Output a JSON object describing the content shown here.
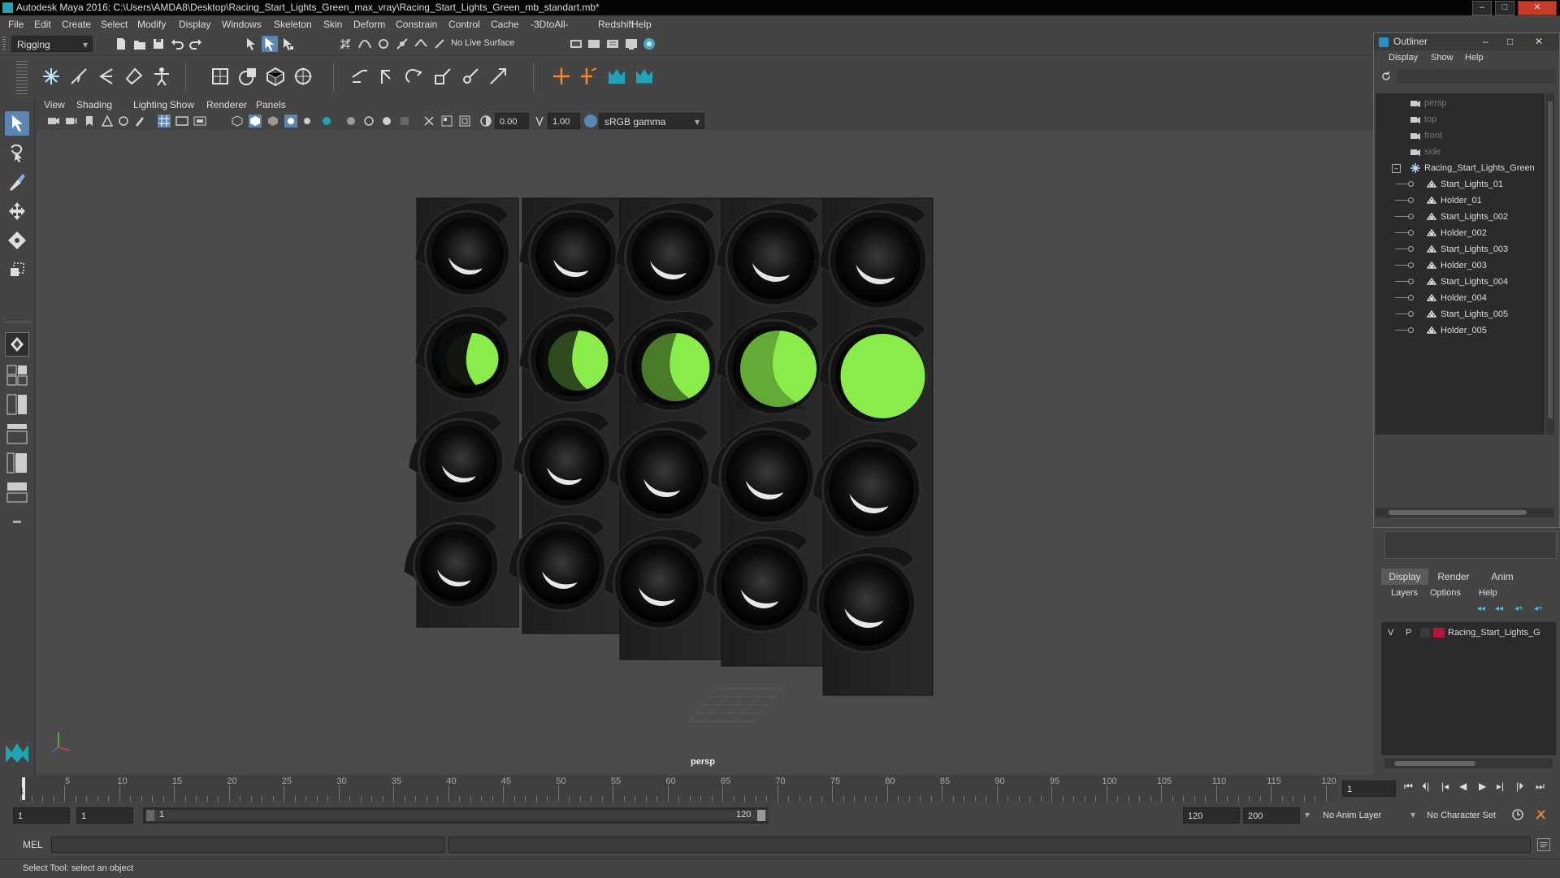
{
  "window": {
    "title": "Autodesk Maya 2016: C:\\Users\\AMDA8\\Desktop\\Racing_Start_Lights_Green_max_vray\\Racing_Start_Lights_Green_mb_standart.mb*",
    "minimize": "–",
    "maximize": "□",
    "close": "✕"
  },
  "menubar": [
    "File",
    "Edit",
    "Create",
    "Select",
    "Modify",
    "Display",
    "Windows",
    "Skeleton",
    "Skin",
    "Deform",
    "Constrain",
    "Control",
    "Cache",
    "-3DtoAll-",
    "Redshift",
    "Help"
  ],
  "statusline": {
    "menuset": "Rigging",
    "live_surface": "No Live Surface"
  },
  "panel": {
    "menus": [
      "View",
      "Shading",
      "Lighting",
      "Show",
      "Renderer",
      "Panels"
    ],
    "exposure": "0.00",
    "gamma": "1.00",
    "color_space": "sRGB gamma",
    "camera": "persp"
  },
  "outliner": {
    "title": "Outliner",
    "menus": [
      "Display",
      "Show",
      "Help"
    ],
    "items": [
      {
        "label": "persp",
        "type": "camera",
        "dim": true,
        "indent": 0
      },
      {
        "label": "top",
        "type": "camera",
        "dim": true,
        "indent": 0
      },
      {
        "label": "front",
        "type": "camera",
        "dim": true,
        "indent": 0
      },
      {
        "label": "side",
        "type": "camera",
        "dim": true,
        "indent": 0
      },
      {
        "label": "Racing_Start_Lights_Green",
        "type": "group",
        "dim": false,
        "indent": 0
      },
      {
        "label": "Start_Lights_01",
        "type": "mesh",
        "dim": false,
        "indent": 1
      },
      {
        "label": "Holder_01",
        "type": "mesh",
        "dim": false,
        "indent": 1
      },
      {
        "label": "Start_Lights_002",
        "type": "mesh",
        "dim": false,
        "indent": 1
      },
      {
        "label": "Holder_002",
        "type": "mesh",
        "dim": false,
        "indent": 1
      },
      {
        "label": "Start_Lights_003",
        "type": "mesh",
        "dim": false,
        "indent": 1
      },
      {
        "label": "Holder_003",
        "type": "mesh",
        "dim": false,
        "indent": 1
      },
      {
        "label": "Start_Lights_004",
        "type": "mesh",
        "dim": false,
        "indent": 1
      },
      {
        "label": "Holder_004",
        "type": "mesh",
        "dim": false,
        "indent": 1
      },
      {
        "label": "Start_Lights_005",
        "type": "mesh",
        "dim": false,
        "indent": 1
      },
      {
        "label": "Holder_005",
        "type": "mesh",
        "dim": false,
        "indent": 1
      }
    ]
  },
  "layers": {
    "tabs": [
      "Display",
      "Render",
      "Anim"
    ],
    "active_tab": "Display",
    "menus": [
      "Layers",
      "Options",
      "Help"
    ],
    "rows": [
      {
        "v": "V",
        "p": "P",
        "name": "Racing_Start_Lights_G",
        "color": "#b3163a"
      }
    ]
  },
  "timeline": {
    "ticks": [
      "5",
      "10",
      "15",
      "20",
      "25",
      "30",
      "35",
      "40",
      "45",
      "50",
      "55",
      "60",
      "65",
      "70",
      "75",
      "80",
      "85",
      "90",
      "95",
      "100",
      "105",
      "110",
      "115",
      "120"
    ],
    "current_marker": "1",
    "current_frame": "1"
  },
  "range": {
    "start": "1",
    "playback_start": "1",
    "slider_start": "1",
    "slider_end": "120",
    "playback_end": "120",
    "end": "200",
    "anim_layer": "No Anim Layer",
    "character_set": "No Character Set"
  },
  "cmdline": {
    "label": "MEL"
  },
  "helpline": {
    "text": "Select Tool: select an object"
  },
  "colors": {
    "lit": "#89ec4a",
    "accent": "#5b86b3"
  }
}
